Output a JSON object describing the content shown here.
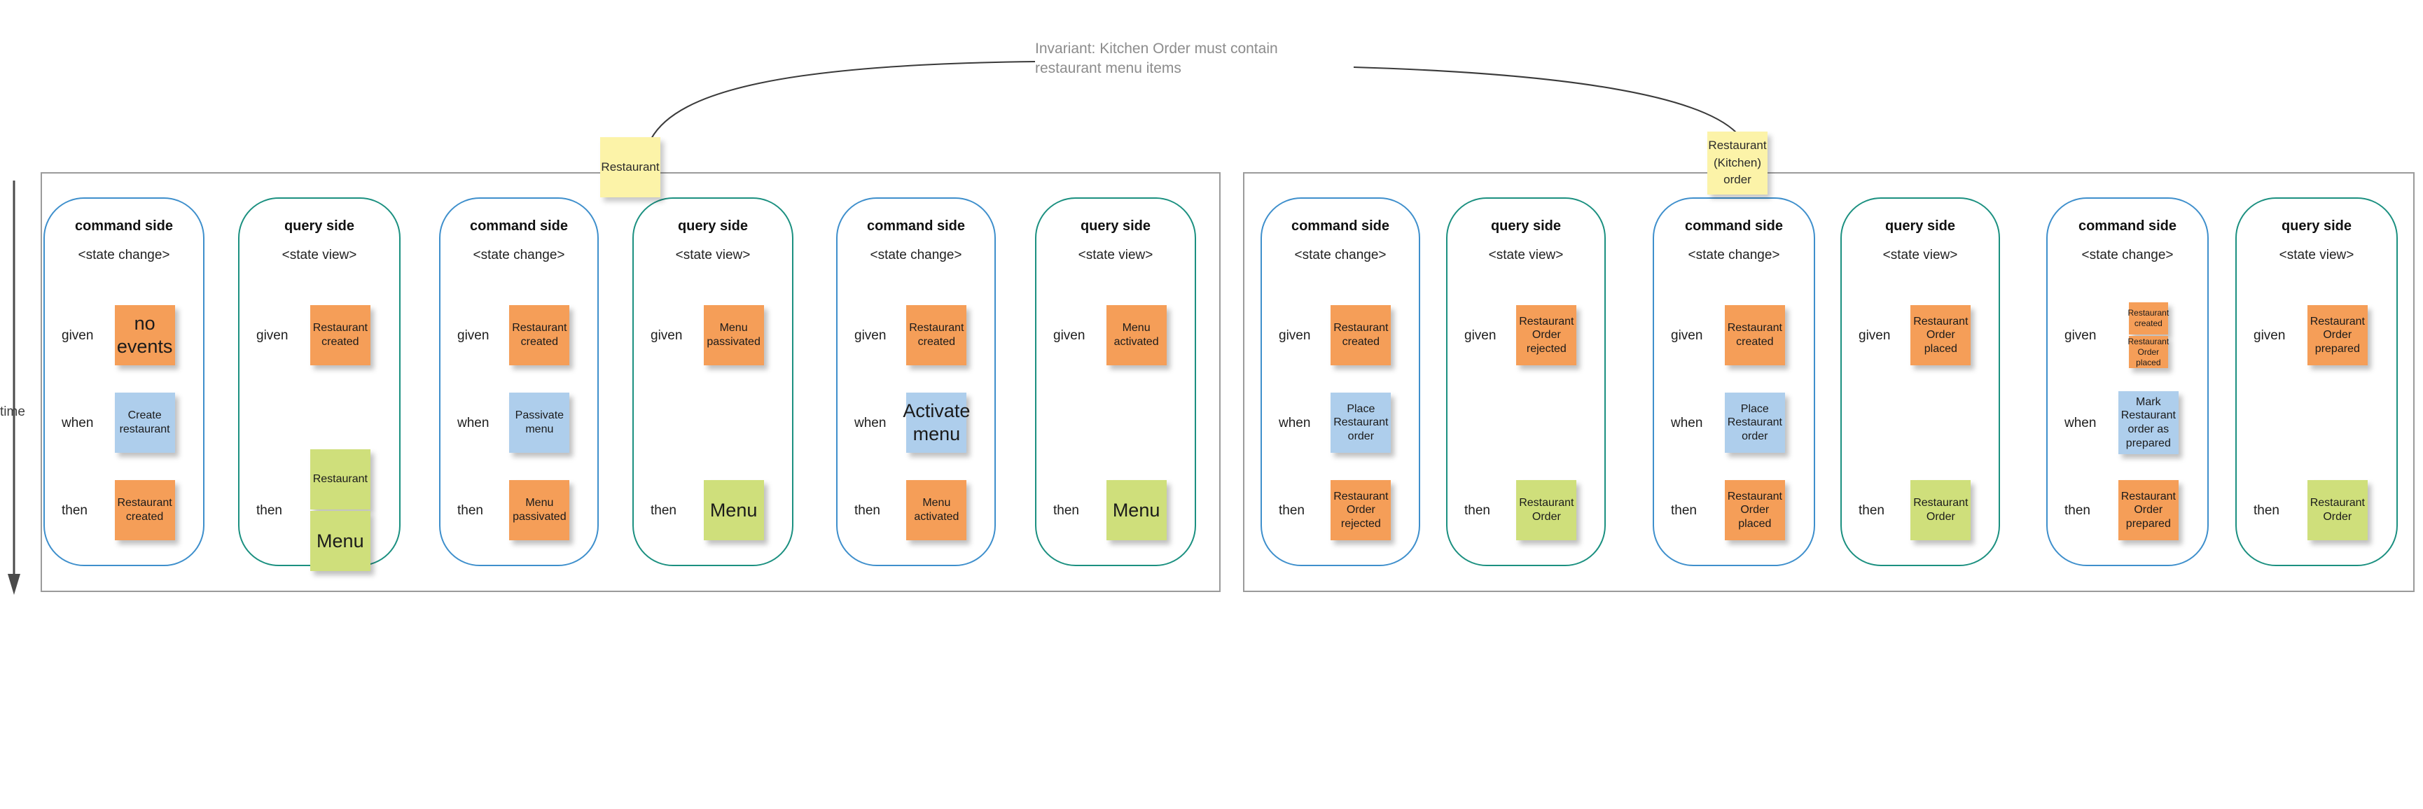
{
  "annotation": {
    "invariant": "Invariant: Kitchen Order must contain\nrestaurant menu items"
  },
  "axis": {
    "time_label": "time"
  },
  "colors": {
    "event": "#f59e58",
    "command": "#aeceec",
    "view": "#cfdf7b",
    "aggregate": "#fcf3a8",
    "command_side_border": "#3e8fcc",
    "query_side_border": "#1b9080",
    "group_border": "#9b9b9b",
    "annotation_text": "#8c8c8c"
  },
  "labels": {
    "command_side": "command side",
    "query_side": "query side",
    "state_change": "<state change>",
    "state_view": "<state view>",
    "given": "given",
    "when": "when",
    "then": "then"
  },
  "aggregates": [
    {
      "id": "restaurant",
      "label": "Restaurant"
    },
    {
      "id": "kitchen",
      "label": "Restaurant\n(Kitchen)\norder"
    }
  ],
  "groups": [
    {
      "id": "group-restaurant",
      "aggregate": "Restaurant",
      "panels": [
        {
          "id": "p1",
          "side": "command",
          "title": "command side",
          "subtitle": "<state change>",
          "rows": [
            {
              "label": "given",
              "notes": [
                {
                  "text": "no events",
                  "type": "event",
                  "size": "big"
                }
              ]
            },
            {
              "label": "when",
              "notes": [
                {
                  "text": "Create\nrestaurant",
                  "type": "command",
                  "size": "normal"
                }
              ]
            },
            {
              "label": "then",
              "notes": [
                {
                  "text": "Restaurant\ncreated",
                  "type": "event",
                  "size": "normal"
                }
              ]
            }
          ]
        },
        {
          "id": "p2",
          "side": "query",
          "title": "query side",
          "subtitle": "<state view>",
          "rows": [
            {
              "label": "given",
              "notes": [
                {
                  "text": "Restaurant\ncreated",
                  "type": "event",
                  "size": "normal"
                }
              ]
            },
            {
              "label": "then",
              "notes": [
                {
                  "text": "Restaurant",
                  "type": "view",
                  "size": "normal"
                },
                {
                  "text": "Menu",
                  "type": "view",
                  "size": "big"
                }
              ]
            }
          ]
        },
        {
          "id": "p3",
          "side": "command",
          "title": "command side",
          "subtitle": "<state change>",
          "rows": [
            {
              "label": "given",
              "notes": [
                {
                  "text": "Restaurant\ncreated",
                  "type": "event",
                  "size": "normal"
                }
              ]
            },
            {
              "label": "when",
              "notes": [
                {
                  "text": "Passivate\nmenu",
                  "type": "command",
                  "size": "normal"
                }
              ]
            },
            {
              "label": "then",
              "notes": [
                {
                  "text": "Menu\npassivated",
                  "type": "event",
                  "size": "normal"
                }
              ]
            }
          ]
        },
        {
          "id": "p4",
          "side": "query",
          "title": "query side",
          "subtitle": "<state view>",
          "rows": [
            {
              "label": "given",
              "notes": [
                {
                  "text": "Menu\npassivated",
                  "type": "event",
                  "size": "normal"
                }
              ]
            },
            {
              "label": "then",
              "notes": [
                {
                  "text": "Menu",
                  "type": "view",
                  "size": "big"
                }
              ]
            }
          ]
        },
        {
          "id": "p5",
          "side": "command",
          "title": "command side",
          "subtitle": "<state change>",
          "rows": [
            {
              "label": "given",
              "notes": [
                {
                  "text": "Restaurant\ncreated",
                  "type": "event",
                  "size": "normal"
                }
              ]
            },
            {
              "label": "when",
              "notes": [
                {
                  "text": "Activate\nmenu",
                  "type": "command",
                  "size": "big"
                }
              ]
            },
            {
              "label": "then",
              "notes": [
                {
                  "text": "Menu\nactivated",
                  "type": "event",
                  "size": "normal"
                }
              ]
            }
          ]
        },
        {
          "id": "p6",
          "side": "query",
          "title": "query side",
          "subtitle": "<state view>",
          "rows": [
            {
              "label": "given",
              "notes": [
                {
                  "text": "Menu\nactivated",
                  "type": "event",
                  "size": "normal"
                }
              ]
            },
            {
              "label": "then",
              "notes": [
                {
                  "text": "Menu",
                  "type": "view",
                  "size": "big"
                }
              ]
            }
          ]
        }
      ]
    },
    {
      "id": "group-kitchen",
      "aggregate": "Restaurant (Kitchen) order",
      "panels": [
        {
          "id": "p7",
          "side": "command",
          "title": "command side",
          "subtitle": "<state change>",
          "rows": [
            {
              "label": "given",
              "notes": [
                {
                  "text": "Restaurant\ncreated",
                  "type": "event",
                  "size": "normal"
                }
              ]
            },
            {
              "label": "when",
              "notes": [
                {
                  "text": "Place\nRestaurant\norder",
                  "type": "command",
                  "size": "normal"
                }
              ]
            },
            {
              "label": "then",
              "notes": [
                {
                  "text": "Restaurant\nOrder\nrejected",
                  "type": "event",
                  "size": "normal"
                }
              ]
            }
          ]
        },
        {
          "id": "p8",
          "side": "query",
          "title": "query side",
          "subtitle": "<state view>",
          "rows": [
            {
              "label": "given",
              "notes": [
                {
                  "text": "Restaurant\nOrder\nrejected",
                  "type": "event",
                  "size": "normal"
                }
              ]
            },
            {
              "label": "then",
              "notes": [
                {
                  "text": "Restaurant\nOrder",
                  "type": "view",
                  "size": "normal"
                }
              ]
            }
          ]
        },
        {
          "id": "p9",
          "side": "command",
          "title": "command side",
          "subtitle": "<state change>",
          "rows": [
            {
              "label": "given",
              "notes": [
                {
                  "text": "Restaurant\ncreated",
                  "type": "event",
                  "size": "normal"
                }
              ]
            },
            {
              "label": "when",
              "notes": [
                {
                  "text": "Place\nRestaurant\norder",
                  "type": "command",
                  "size": "normal"
                }
              ]
            },
            {
              "label": "then",
              "notes": [
                {
                  "text": "Restaurant\nOrder\nplaced",
                  "type": "event",
                  "size": "normal"
                }
              ]
            }
          ]
        },
        {
          "id": "p10",
          "side": "query",
          "title": "query side",
          "subtitle": "<state view>",
          "rows": [
            {
              "label": "given",
              "notes": [
                {
                  "text": "Restaurant\nOrder\nplaced",
                  "type": "event",
                  "size": "normal"
                }
              ]
            },
            {
              "label": "then",
              "notes": [
                {
                  "text": "Restaurant\nOrder",
                  "type": "view",
                  "size": "normal"
                }
              ]
            }
          ]
        },
        {
          "id": "p11",
          "side": "command",
          "title": "command side",
          "subtitle": "<state change>",
          "rows": [
            {
              "label": "given",
              "notes": [
                {
                  "text": "Restaurant\ncreated",
                  "type": "event",
                  "size": "small"
                },
                {
                  "text": "Restaurant\nOrder\nplaced",
                  "type": "event",
                  "size": "small"
                }
              ]
            },
            {
              "label": "when",
              "notes": [
                {
                  "text": "Mark\nRestaurant\norder as\nprepared",
                  "type": "command",
                  "size": "normal"
                }
              ]
            },
            {
              "label": "then",
              "notes": [
                {
                  "text": "Restaurant\nOrder\nprepared",
                  "type": "event",
                  "size": "normal"
                }
              ]
            }
          ]
        },
        {
          "id": "p12",
          "side": "query",
          "title": "query side",
          "subtitle": "<state view>",
          "rows": [
            {
              "label": "given",
              "notes": [
                {
                  "text": "Restaurant\nOrder\nprepared",
                  "type": "event",
                  "size": "normal"
                }
              ]
            },
            {
              "label": "then",
              "notes": [
                {
                  "text": "Restaurant\nOrder",
                  "type": "view",
                  "size": "normal"
                }
              ]
            }
          ]
        }
      ]
    }
  ]
}
